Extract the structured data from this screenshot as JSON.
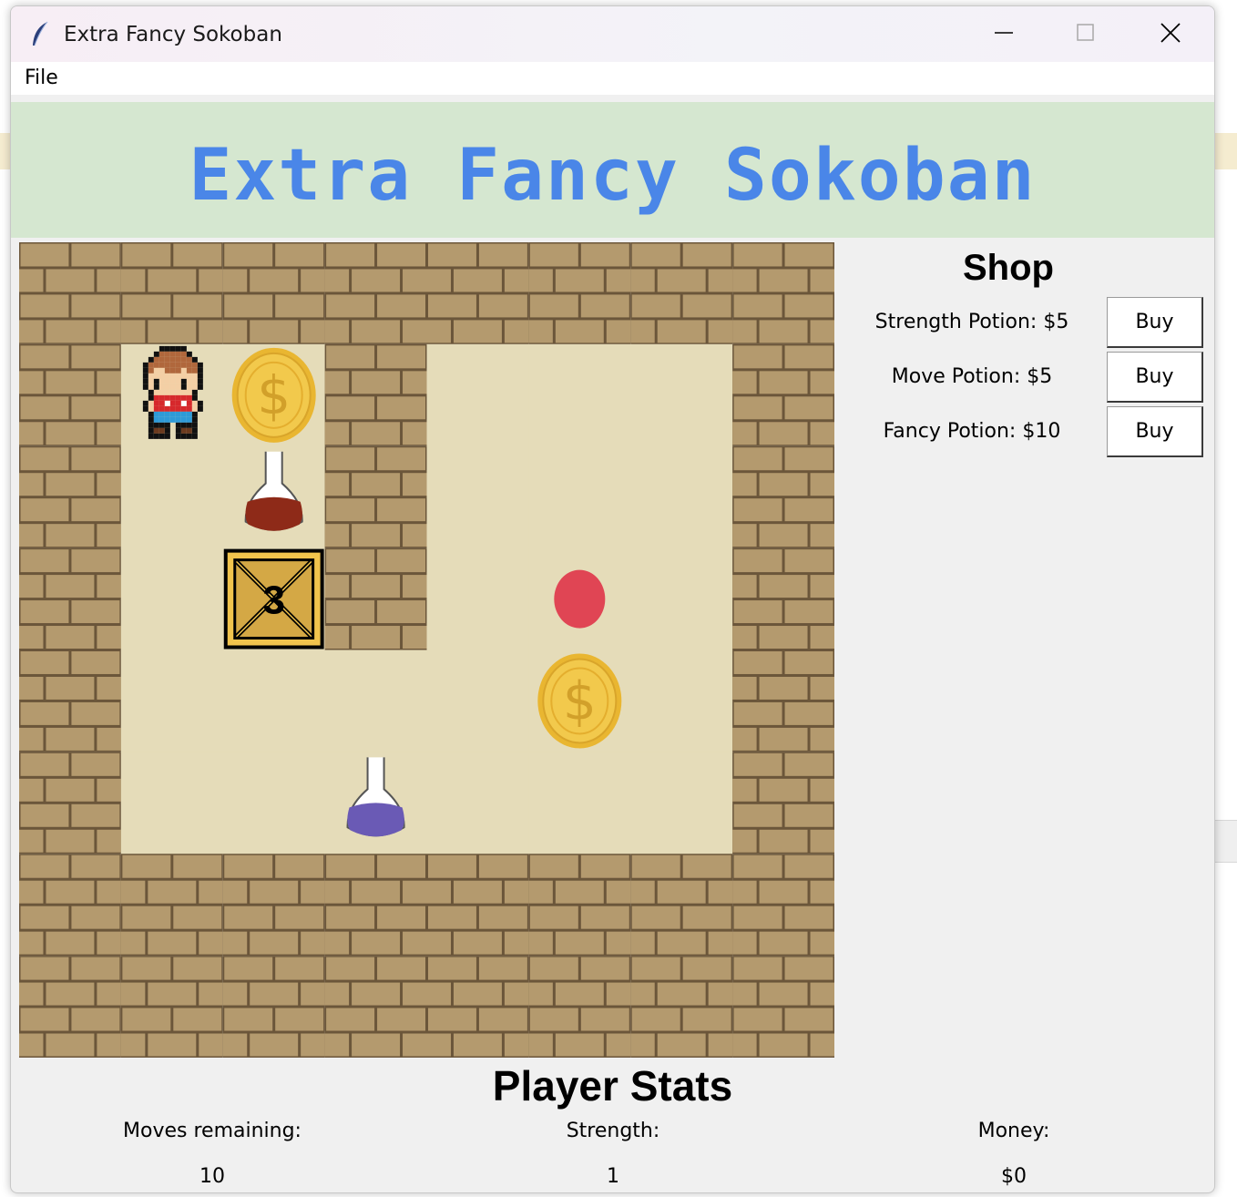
{
  "window": {
    "title": "Extra Fancy Sokoban",
    "controls": [
      "minimize",
      "maximize",
      "close"
    ]
  },
  "menubar": {
    "items": [
      "File"
    ]
  },
  "banner": {
    "title": "Extra Fancy Sokoban",
    "color": "#4a86e8",
    "background": "#d5e7d0"
  },
  "board": {
    "grid": [
      "########",
      "#PC#   #",
      "# R#   #",
      "# 3# G #",
      "#    C #",
      "#  M   #",
      "########",
      "########"
    ],
    "legend": {
      "#": "wall",
      " ": "floor",
      "P": "player",
      "C": "coin",
      "R": "strength-potion",
      "M": "move-potion",
      "3": "crate",
      "G": "goal"
    },
    "crate_label": "3",
    "colors": {
      "wall": "#b49a6e",
      "mortar": "#6b563a",
      "floor": "#e5dcb9",
      "goal": "#e04554",
      "coin": "#f2c94c",
      "crate": "#d4a845",
      "strength_potion": "#8e2a18",
      "move_potion": "#6a5ab5"
    }
  },
  "shop": {
    "title": "Shop",
    "items": [
      {
        "label": "Strength Potion: $5",
        "button": "Buy"
      },
      {
        "label": "Move Potion: $5",
        "button": "Buy"
      },
      {
        "label": "Fancy Potion: $10",
        "button": "Buy"
      }
    ]
  },
  "stats": {
    "title": "Player Stats",
    "moves_label": "Moves remaining:",
    "moves_value": "10",
    "strength_label": "Strength:",
    "strength_value": "1",
    "money_label": "Money:",
    "money_value": "$0"
  }
}
